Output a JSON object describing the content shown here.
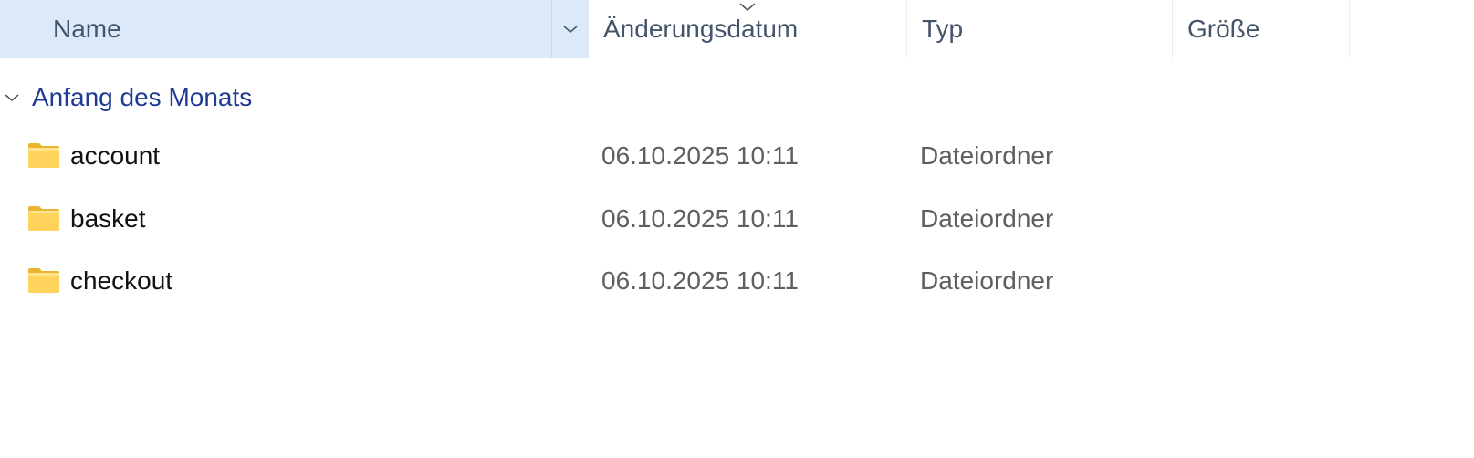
{
  "columns": {
    "name": "Name",
    "modified": "Änderungsdatum",
    "type": "Typ",
    "size": "Größe"
  },
  "sort": {
    "column": "modified",
    "direction": "descending"
  },
  "group": {
    "title": "Anfang des Monats",
    "expanded": true
  },
  "files": [
    {
      "name": "account",
      "modified": "06.10.2025 10:11",
      "type": "Dateiordner",
      "size": "",
      "icon": "folder-icon"
    },
    {
      "name": "basket",
      "modified": "06.10.2025 10:11",
      "type": "Dateiordner",
      "size": "",
      "icon": "folder-icon"
    },
    {
      "name": "checkout",
      "modified": "06.10.2025 10:11",
      "type": "Dateiordner",
      "size": "",
      "icon": "folder-icon"
    }
  ],
  "colors": {
    "header_selected_bg": "#dbe9f8",
    "header_text": "#44546a",
    "group_title": "#1f3a93",
    "folder_yellow": "#f8c94a"
  }
}
